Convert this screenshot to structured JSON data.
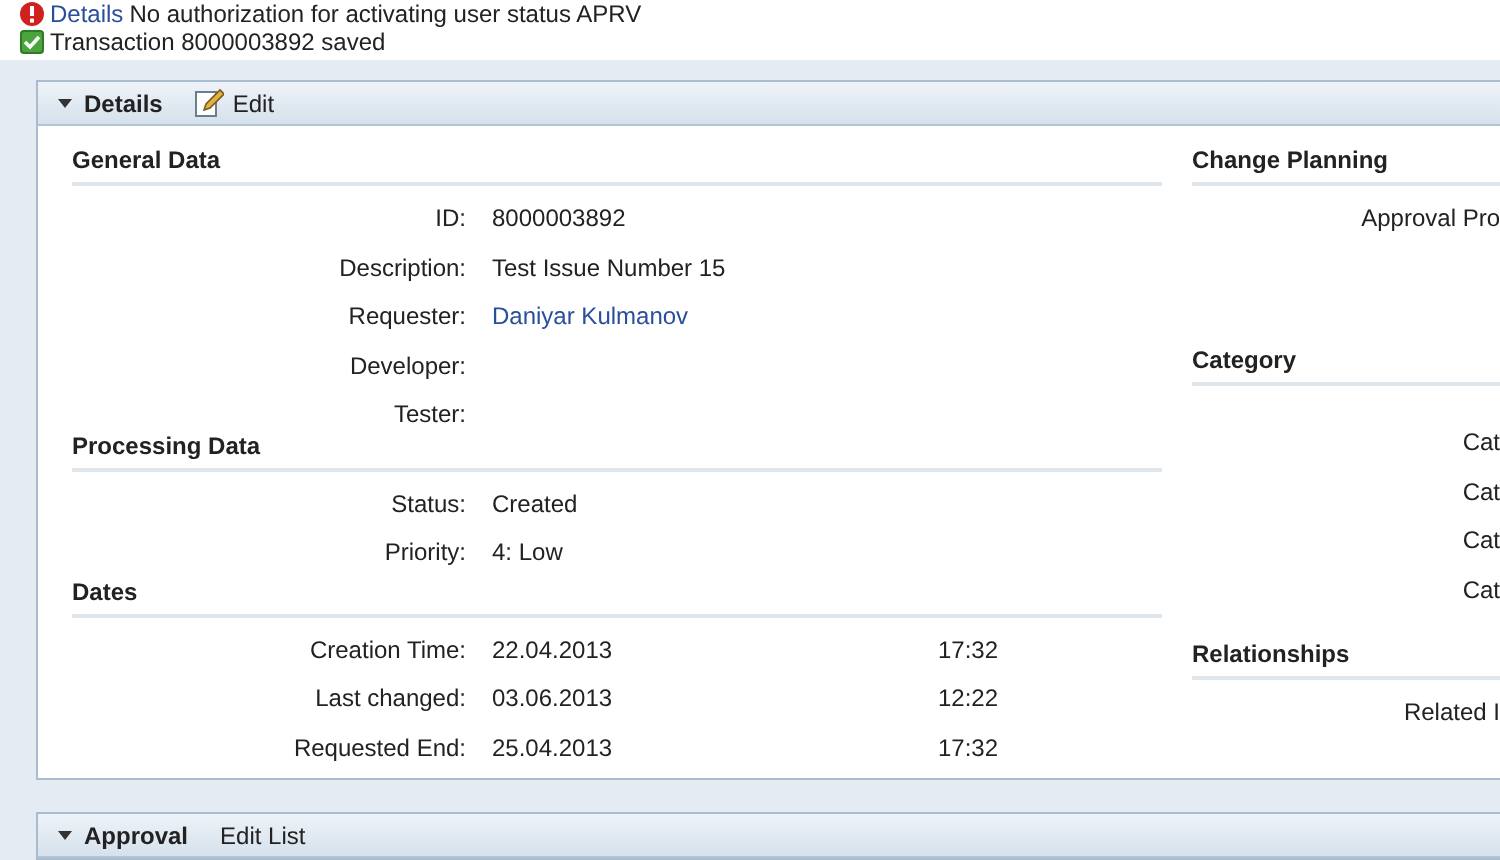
{
  "messages": [
    {
      "kind": "error",
      "link": "Details",
      "text": "No authorization for activating user status APRV"
    },
    {
      "kind": "success",
      "text": "Transaction 8000003892 saved"
    }
  ],
  "details_panel": {
    "title": "Details",
    "expanded": true,
    "actions": [
      "Edit"
    ],
    "left_sections": [
      {
        "title": "General Data",
        "fields": [
          {
            "label": "ID:",
            "value": "8000003892"
          },
          {
            "label": "Description:",
            "value": "Test Issue Number 15"
          },
          {
            "label": "Requester:",
            "value": "Daniyar Kulmanov",
            "kind": "link"
          },
          {
            "label": "Developer:"
          },
          {
            "label": "Tester:"
          }
        ]
      },
      {
        "title": "Processing Data",
        "fields": [
          {
            "label": "Status:",
            "value": "Created"
          },
          {
            "label": "Priority:",
            "value": "4: Low"
          }
        ]
      },
      {
        "title": "Dates",
        "fields": [
          {
            "label": "Creation Time:",
            "value": "22.04.2013",
            "time": "17:32"
          },
          {
            "label": "Last changed:",
            "value": "03.06.2013",
            "time": "12:22"
          },
          {
            "label": "Requested End:",
            "value": "25.04.2013",
            "time": "17:32"
          }
        ]
      }
    ],
    "right_sections": [
      {
        "title": "Change Planning",
        "fields": [
          "Approval Pro"
        ]
      },
      {
        "title": "Category",
        "fields": [
          "Cat",
          "Cat",
          "Cat",
          "Cat"
        ]
      },
      {
        "title": "Relationships",
        "fields": [
          "Related I"
        ]
      }
    ]
  },
  "approval_panel": {
    "title": "Approval",
    "expanded": true,
    "actions": [
      "Edit List"
    ]
  }
}
